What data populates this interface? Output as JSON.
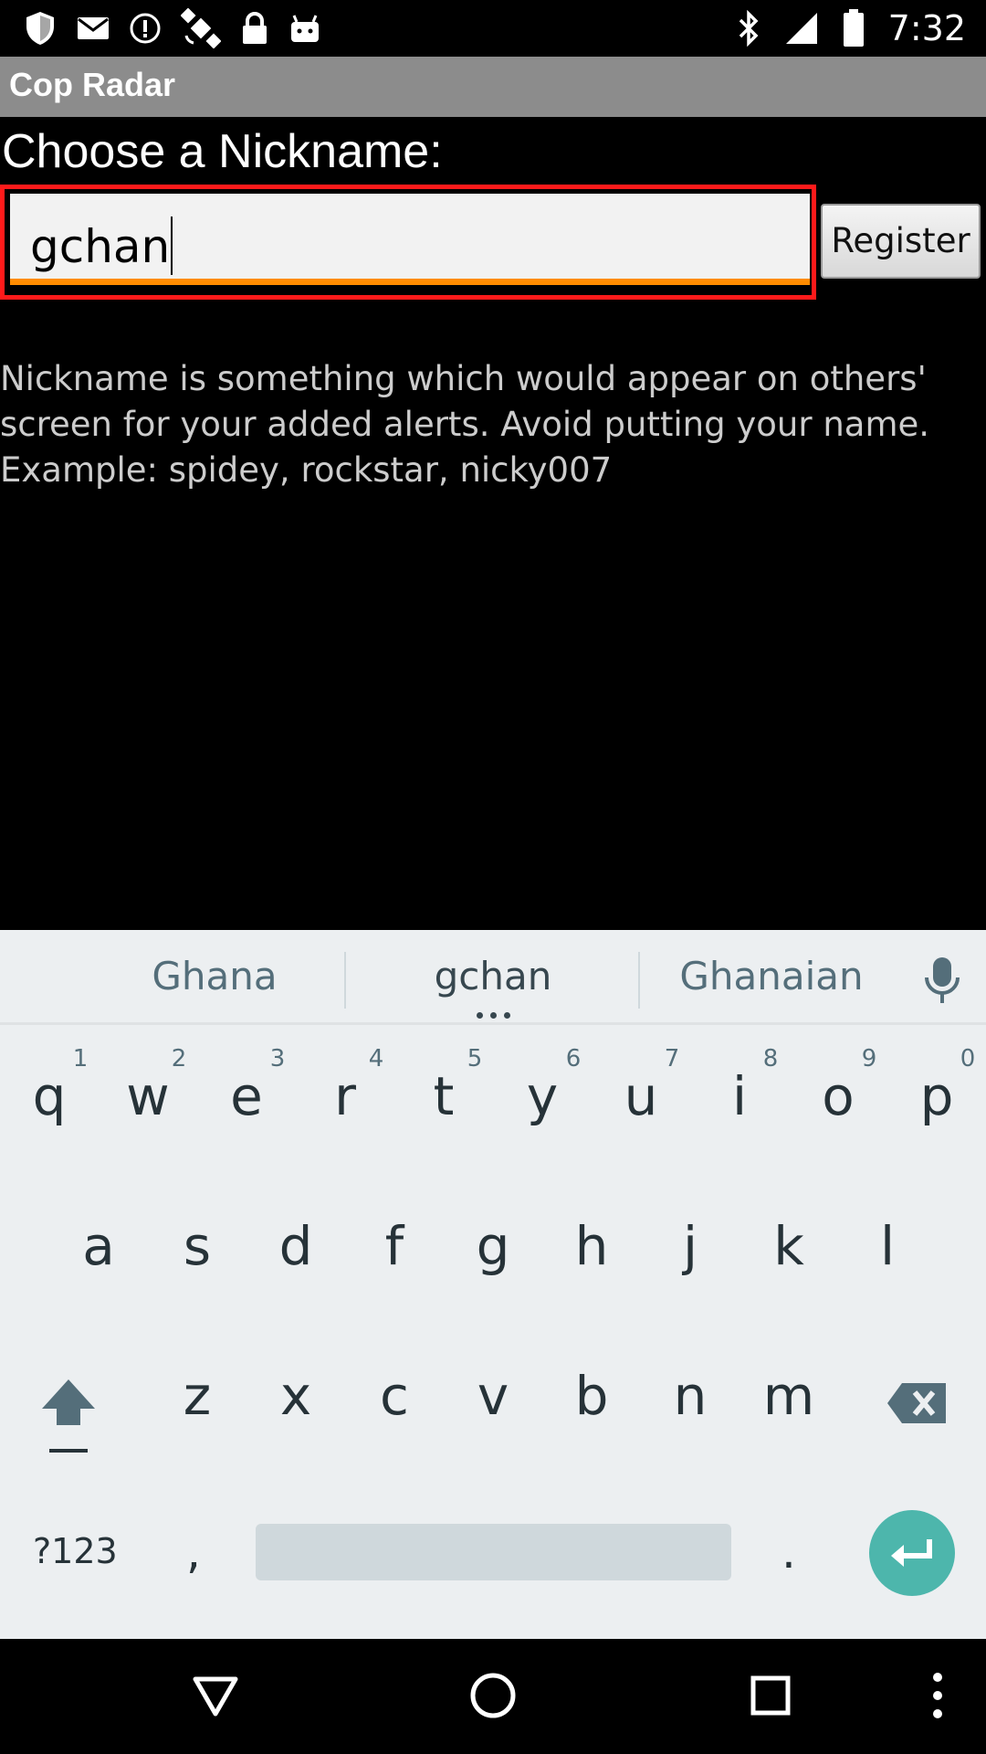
{
  "status_bar": {
    "time": "7:32",
    "icons": [
      "shield-icon",
      "mail-icon",
      "info-icon",
      "satellite-icon",
      "lock-icon",
      "android-icon",
      "bluetooth-icon",
      "signal-icon",
      "battery-icon"
    ]
  },
  "app": {
    "title": "Cop Radar"
  },
  "form": {
    "heading": "Choose a Nickname:",
    "nickname_value": "gchan",
    "register_label": "Register",
    "help_line1": "Nickname is something which would appear on others'",
    "help_line2": "screen for your added alerts. Avoid putting your name.",
    "help_line3": "Example: spidey, rockstar, nicky007"
  },
  "keyboard": {
    "suggestions": [
      "Ghana",
      "gchan",
      "Ghanaian"
    ],
    "row1": [
      "q",
      "w",
      "e",
      "r",
      "t",
      "y",
      "u",
      "i",
      "o",
      "p"
    ],
    "row1_hints": [
      "1",
      "2",
      "3",
      "4",
      "5",
      "6",
      "7",
      "8",
      "9",
      "0"
    ],
    "row2": [
      "a",
      "s",
      "d",
      "f",
      "g",
      "h",
      "j",
      "k",
      "l"
    ],
    "row3": [
      "z",
      "x",
      "c",
      "v",
      "b",
      "n",
      "m"
    ],
    "symbols_label": "?123",
    "comma_label": ",",
    "period_label": ".",
    "accent_color": "#4db6ac"
  },
  "nav_bar": {
    "icons": [
      "back-icon",
      "home-icon",
      "recents-icon",
      "more-icon"
    ]
  }
}
